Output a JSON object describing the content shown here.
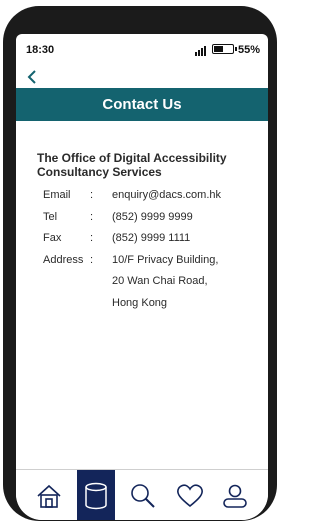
{
  "status_bar": {
    "time": "18:30",
    "battery_percent": "55%",
    "battery_level": 0.55
  },
  "header": {
    "title": "Contact Us",
    "back_icon": "chevron-left-icon",
    "bar_color": "#14636f"
  },
  "contact": {
    "organization": "The Office of Digital Accessibility Consultancy Services",
    "separator": ":",
    "email_label": "Email",
    "email": "enquiry@dacs.com.hk",
    "tel_label": "Tel",
    "tel": "(852) 9999 9999",
    "fax_label": "Fax",
    "fax": "(852) 9999 1111",
    "address_label": "Address",
    "address_lines": [
      "10/F Privacy Building,",
      "20 Wan Chai Road,",
      "Hong Kong"
    ]
  },
  "tab_bar": {
    "tabs": [
      {
        "icon": "home-icon",
        "active": false
      },
      {
        "icon": "database-icon",
        "active": true
      },
      {
        "icon": "search-icon",
        "active": false
      },
      {
        "icon": "heart-icon",
        "active": false
      },
      {
        "icon": "user-icon",
        "active": false
      }
    ],
    "active_color": "#13255a"
  }
}
